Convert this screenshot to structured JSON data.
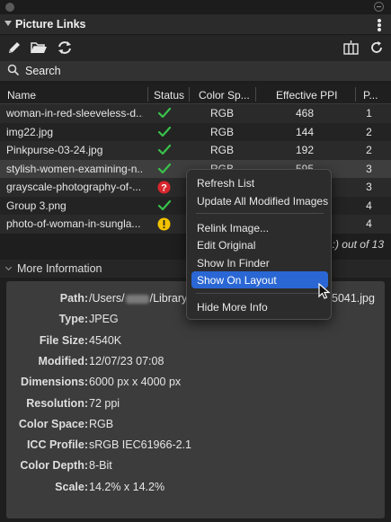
{
  "panel": {
    "title": "Picture Links"
  },
  "toolbar": {
    "icons": [
      "pencil-icon",
      "folder-icon",
      "relink-icon",
      "columns-icon",
      "refresh-icon"
    ]
  },
  "search": {
    "placeholder": "Search"
  },
  "table": {
    "columns": [
      "Name",
      "Status",
      "Color Sp...",
      "Effective PPI",
      "P..."
    ],
    "rows": [
      {
        "name": "woman-in-red-sleeveless-d...",
        "status": "ok",
        "color_space": "RGB",
        "ppi": "468",
        "page": "1"
      },
      {
        "name": "img22.jpg",
        "status": "ok",
        "color_space": "RGB",
        "ppi": "144",
        "page": "2"
      },
      {
        "name": "Pinkpurse-03-24.jpg",
        "status": "ok",
        "color_space": "RGB",
        "ppi": "192",
        "page": "2"
      },
      {
        "name": "stylish-women-examining-n...",
        "status": "ok",
        "color_space": "RGB",
        "ppi": "595",
        "page": "3"
      },
      {
        "name": "grayscale-photography-of-...",
        "status": "missing",
        "color_space": "",
        "ppi": "",
        "page": "3"
      },
      {
        "name": "Group 3.png",
        "status": "ok",
        "color_space": "",
        "ppi": "",
        "page": "4"
      },
      {
        "name": "photo-of-woman-in-sungla...",
        "status": "warning",
        "color_space": "",
        "ppi": "",
        "page": "4"
      }
    ],
    "footer_count": ":) out of 13"
  },
  "more_info": {
    "title": "More Information",
    "fields": [
      {
        "label": "Path:",
        "value_start": "/Users/",
        "value_mid": "/Library",
        "value_end": "5041.jpg"
      },
      {
        "label": "Type:",
        "value": "JPEG"
      },
      {
        "label": "File Size:",
        "value": "4540K"
      },
      {
        "label": "Modified:",
        "value": "12/07/23  07:08"
      },
      {
        "label": "Dimensions:",
        "value": "6000 px x 4000 px"
      },
      {
        "label": "Resolution:",
        "value": "72 ppi"
      },
      {
        "label": "Color Space:",
        "value": "RGB"
      },
      {
        "label": "ICC Profile:",
        "value": "sRGB IEC61966-2.1"
      },
      {
        "label": "Color Depth:",
        "value": "8-Bit"
      },
      {
        "label": "Scale:",
        "value": "14.2% x 14.2%"
      }
    ]
  },
  "context_menu": {
    "items": [
      "Refresh List",
      "Update All Modified Images",
      "Relink Image...",
      "Edit Original",
      "Show In Finder",
      "Show On Layout",
      "Hide More Info"
    ],
    "active_item": "Show On Layout"
  },
  "colors": {
    "accent": "#2a67d4",
    "status_ok": "#39c24a",
    "status_missing": "#d9262c",
    "status_warning": "#f2c200"
  }
}
